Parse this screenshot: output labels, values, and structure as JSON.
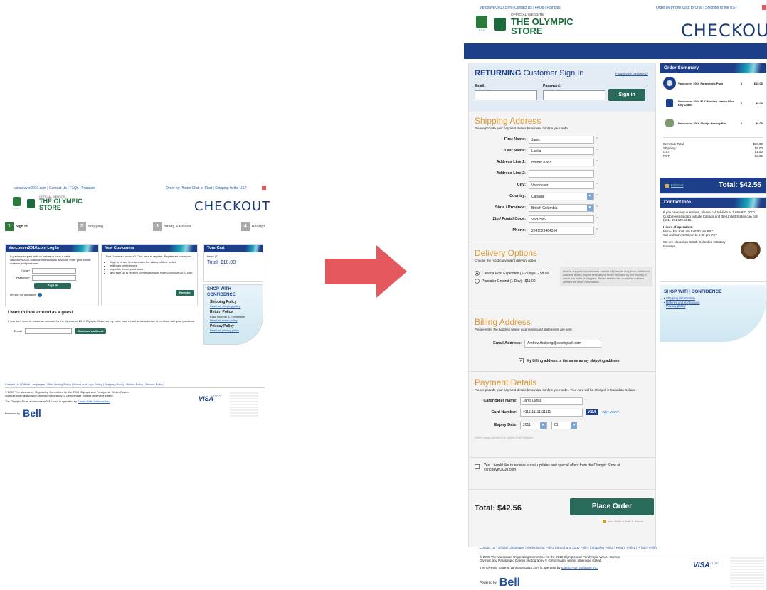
{
  "left": {
    "top_links": "vancouver2010.com | Contact Us | FAQs | Français",
    "top_right": "Order by Phone  Click to Chat | Shipping to the US?",
    "logo": {
      "line1": "OFFICIAL WEBSITE",
      "line2": "THE OLYMPIC",
      "line3": "STORE"
    },
    "checkout": "CHECKOUT",
    "steps": [
      {
        "num": "1",
        "label": "Sign In"
      },
      {
        "num": "2",
        "label": "Shipping"
      },
      {
        "num": "3",
        "label": "Billing & Review"
      },
      {
        "num": "4",
        "label": "Receipt"
      }
    ],
    "login": {
      "title": "Vancouver2010.com Log In",
      "intro": "If you've shopped with us before or have a valid vancouver2010.com communications account, enter your e-mail address and password.",
      "email_label": "E-mail*",
      "password_label": "Password*",
      "signin": "Sign In",
      "forgot": "I forgot my password"
    },
    "new_customers": {
      "title": "New Customers",
      "intro": "Don't have an account? Click here to register. Registered users can:",
      "bullets": [
        "Sign in at any time to check the status of their orders",
        "edit their preferences",
        "expedite future purchases",
        "and sign up to receive communications from vancouver2010.com"
      ],
      "register": "Register"
    },
    "cart": {
      "title": "Your Cart",
      "items": "Items (2)",
      "total": "Total: $18.00"
    },
    "shop": {
      "title": "SHOP WITH CONFIDENCE",
      "shipping": "Shipping Policy",
      "shipping_link": "Read full shipping policy",
      "return": "Return Policy",
      "return_sub": "Easy Returns & Exchanges",
      "return_link": "Read full return policy",
      "privacy": "Privacy Policy",
      "privacy_link": "Read full privacy policy"
    },
    "guest": {
      "title": "I want to look around as a guest",
      "text": "If you don't want to create an account for the Vancouver 2010 Olympic Store, simply enter your e-mail address below to continue with your purchase.",
      "email_label": "E-mail",
      "button": "Checkout As Guest"
    },
    "footer": {
      "links": "Contact Us | Official Languages | Web Linking Policy | Brand and Logo Policy | Shipping Policy | Return Policy | Privacy Policy",
      "copy1": "© 2009 The Vancouver Organizing Committee for the 2010 Olympic and Paralympic Winter Games",
      "copy2": "Olympic and Paralympic Games photography © Getty Image, unless otherwise stated.",
      "copy3": "The Olympic Store at vancouver2010.com is operated by",
      "operator": "Elastic Path Software Inc.",
      "powered": "Powered by",
      "bell": "Bell",
      "visa": "VISA"
    }
  },
  "right": {
    "top_links": "vancouver2010.com | Contact Us | FAQs | Français",
    "top_right": "Order by Phone  Click to Chat | Shipping to the US?",
    "logo": {
      "line1": "OFFICIAL WEBSITE",
      "line2": "THE OLYMPIC",
      "line3": "STORE"
    },
    "checkout": "CHECKOUT",
    "returning": {
      "title_bold": "RETURNING",
      "title_rest": "Customer Sign In",
      "forgot": "Forgot your password?",
      "email": "Email:",
      "password": "Password:",
      "signin": "Sign in"
    },
    "shipping": {
      "title": "Shipping Address",
      "intro": "Please provide your payment details below and confirm your order",
      "fields": [
        {
          "label": "First Name:",
          "value": "Janis"
        },
        {
          "label": "Last Name:",
          "value": "Lanila"
        },
        {
          "label": "Address Line 1:",
          "value": "Homer 8383"
        },
        {
          "label": "Address Line 2:",
          "value": ""
        },
        {
          "label": "City:",
          "value": "Vancouver"
        },
        {
          "label": "Country:",
          "value": "Canada"
        },
        {
          "label": "State / Province:",
          "value": "British Columbia"
        },
        {
          "label": "Zip / Postal Code:",
          "value": "V6B2W6"
        },
        {
          "label": "Phone:",
          "value": "2349523464356"
        }
      ]
    },
    "delivery": {
      "title": "Delivery Options",
      "intro": "Choose the most convenient delivery option",
      "opt1": "Canada Post Expedited (1-2 Days) - $8.00",
      "opt2": "Purolator Ground (1 Day) - $11.00",
      "note": "Orders shipped to customers outside of Canada may incur additional customs duties, import fees and/or taxes imposed by the country to which the order is shipped. Please refer to the country's customs website for more information."
    },
    "billing": {
      "title": "Billing Address",
      "intro": "Please enter the address where your credit card statements are sent",
      "email_label": "Email Address:",
      "email_value": "Andrew.thalberg@elasticpath.com",
      "same": "My billing address is the same as my shipping address"
    },
    "payment": {
      "title": "Payment Details",
      "intro": "Please provide your payment details below and confirm your order. Your card will be charged in Canadian Dollars.",
      "holder_label": "Cardholder Name:",
      "holder_value": "Janis Lanila",
      "number_label": "Card Number:",
      "number_value": "4111111111111111",
      "why_visa": "Why VISA?",
      "visa": "VISA",
      "expiry_label": "Expiry Date:",
      "year": "2011",
      "month": "01",
      "operated": "Online store operated by Elastic Path Software"
    },
    "optin": "Yes, I would like to receive e-mail updates and special offers from the Olympic Store at vancouver2010.com",
    "total": "Total: $42.56",
    "place_order": "Place Order",
    "secure": "Your Order is Safe & Secure",
    "summary": {
      "title": "Order Summary",
      "items": [
        {
          "name": "Vancouver 2010 Paralympic Puck",
          "qty": "1",
          "price": "$15.00"
        },
        {
          "name": "Vancouver 2010 PUC Hockey Jersey Blue Key Chain",
          "qty": "1",
          "price": "$9.00"
        },
        {
          "name": "Vancouver 2010 Sledge Hockey Pin",
          "qty": "1",
          "price": "$6.00"
        }
      ],
      "subtotal_label": "Item Sub-Total:",
      "subtotal": "$30.00",
      "shipping_label": "Shipping:",
      "shipping": "$8.00",
      "gst_label": "GST",
      "gst": "$1.90",
      "pst_label": "PST",
      "pst": "$2.66",
      "edit_cart": "Edit Cart",
      "total": "Total: $42.56"
    },
    "contact": {
      "title": "Contact Info",
      "line1": "If you have any questions, please call toll-free at 1.866.933.2010.",
      "line2": "Customers residing outside Canada and the United States can call (001) 604.629.5015.",
      "hours_title": "Hours of operation:",
      "hours1": "Mon – Fri: 9:00 am to 8:00 pm PST",
      "hours2": "Sat and Sun: 9:00 am to 5:00 pm PST",
      "closed": "We are closed on British Columbia statutory holidays."
    },
    "shop": {
      "title": "SHOP WITH CONFIDENCE",
      "l1": "Shipping information",
      "l2": "Returns and exchanges",
      "l3": "Privacy policy"
    },
    "footer": {
      "links": "Contact Us | Official Languages | Web Linking Policy | Brand and Logo Policy | Shipping Policy | Return Policy | Privacy Policy",
      "copy1": "© 2009 The Vancouver Organizing Committee for the 2010 Olympic and Paralympic Winter Games",
      "copy2": "Olympic and Paralympic Games photography © Getty Image, unless otherwise stated.",
      "copy3": "The Olympic Store at vancouver2010.com is operated by",
      "operator": "Elastic Path Software Inc.",
      "powered": "Powered by",
      "bell": "Bell",
      "visa": "VISA"
    }
  },
  "colors": {
    "accent": "#e4575c",
    "navy": "#1d3f8a",
    "green": "#1a6b3a",
    "orange": "#e09830"
  }
}
